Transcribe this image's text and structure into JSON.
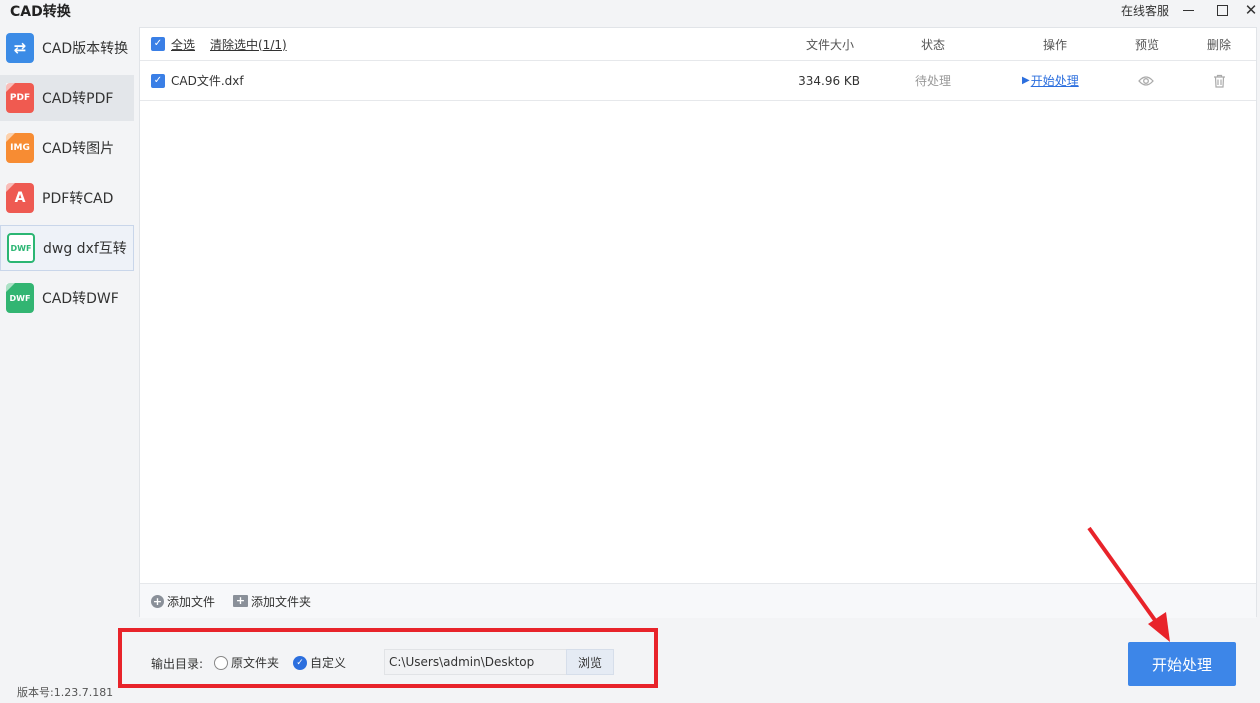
{
  "window": {
    "title": "CAD转换",
    "support": "在线客服",
    "min_icon": "minimize-icon",
    "max_icon": "maximize-icon",
    "close_glyph": "✕"
  },
  "sidebar": {
    "items": [
      {
        "label": "CAD版本转换",
        "icon": "swap-icon",
        "glyph": "⇄",
        "color": "#3b8be6"
      },
      {
        "label": "CAD转PDF",
        "icon": "pdf-icon",
        "glyph": "PDF",
        "color": "#f05a50"
      },
      {
        "label": "CAD转图片",
        "icon": "image-icon",
        "glyph": "IMG",
        "color": "#f78c33"
      },
      {
        "label": "PDF转CAD",
        "icon": "pdf-to-cad-icon",
        "glyph": "A",
        "color": "#ee5a52"
      },
      {
        "label": "dwg dxf互转",
        "icon": "dwg-dxf-icon",
        "glyph": "DWF",
        "color": "#2bb673"
      },
      {
        "label": "CAD转DWF",
        "icon": "dwf-icon",
        "glyph": "DWF",
        "color": "#32b572"
      }
    ]
  },
  "table": {
    "select_all": "全选",
    "clear_selection": "清除选中(1/1)",
    "columns": {
      "size": "文件大小",
      "status": "状态",
      "action": "操作",
      "preview": "预览",
      "delete": "删除"
    },
    "rows": [
      {
        "name": "CAD文件.dxf",
        "size": "334.96 KB",
        "status": "待处理",
        "action": "开始处理"
      }
    ]
  },
  "toolbar": {
    "add_file": "添加文件",
    "add_folder": "添加文件夹"
  },
  "output": {
    "label": "输出目录:",
    "option_original": "原文件夹",
    "option_custom": "自定义",
    "selected": "自定义",
    "path": "C:\\Users\\admin\\Desktop",
    "browse": "浏览"
  },
  "version": "版本号:1.23.7.181",
  "start_button": "开始处理",
  "colors": {
    "accent": "#3d86e8",
    "highlight_border": "#e8232a"
  }
}
